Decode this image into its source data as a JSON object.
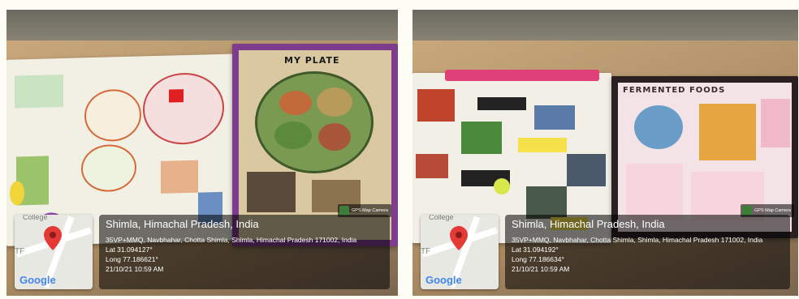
{
  "photos": [
    {
      "location": "Shimla, Himachal Pradesh, India",
      "address": "35VP+MMQ, Navbhahar, Chotta Shimla, Shimla, Himachal Pradesh 171002, India",
      "lat": "Lat 31.094127°",
      "long": "Long 77.186621°",
      "datetime": "21/10/21 10:59 AM",
      "badge": "GPS Map Camera",
      "poster_title": "MY PLATE",
      "map_label": "College",
      "map_side": "TF",
      "google": "Google"
    },
    {
      "location": "Shimla, Himachal Pradesh, India",
      "address": "35VP+MMQ, Navbhahar, Chotta Shimla, Shimla, Himachal Pradesh 171002, India",
      "lat": "Lat 31.094192°",
      "long": "Long 77.186634°",
      "datetime": "21/10/21 10:59 AM",
      "badge": "GPS Map Camera",
      "poster_title": "FERMENTED FOODS",
      "map_label": "College",
      "map_side": "TF",
      "google": "Google"
    }
  ],
  "colors": {
    "pin": "#e53935",
    "google_blue": "#4285F4",
    "google_red": "#EA4335",
    "google_yellow": "#FBBC05",
    "google_green": "#34A853"
  }
}
